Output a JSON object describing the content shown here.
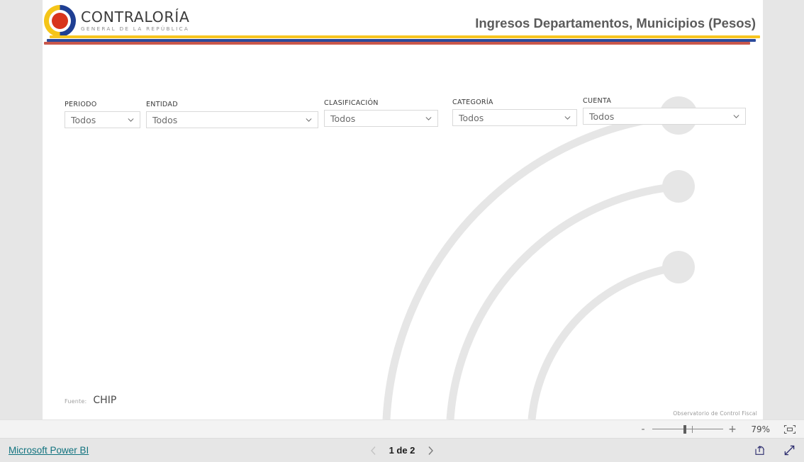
{
  "app": {
    "brand_name": "Microsoft Power BI",
    "background_color": "#e6e6e6"
  },
  "report": {
    "title": "Ingresos Departamentos, Municipios (Pesos)",
    "logo": {
      "name": "CONTRALORÍA",
      "tagline": "GENERAL DE LA REPÚBLICA",
      "icon": "contraloria-logo-icon",
      "ring_left_color": "#f5c518",
      "ring_right_color": "#1f3f93",
      "center_color": "#d8341c"
    },
    "rule_colors": {
      "yellow": "#f7c520",
      "blue": "#2b4a9b",
      "red": "#c0392b"
    }
  },
  "slicers": [
    {
      "label": "PERIODO",
      "value": "Todos",
      "chevron": "chevron-down-icon"
    },
    {
      "label": "ENTIDAD",
      "value": "Todos",
      "chevron": "chevron-down-icon"
    },
    {
      "label": "CLASIFICACIÓN",
      "value": "Todos",
      "chevron": "chevron-down-icon"
    },
    {
      "label": "CATEGORÍA",
      "value": "Todos",
      "chevron": "chevron-down-icon"
    },
    {
      "label": "CUENTA",
      "value": "Todos",
      "chevron": "chevron-down-icon"
    }
  ],
  "footer": {
    "source_label": "Fuente:",
    "source_value": "CHIP",
    "watermark": "Observatorio de Control Fiscal"
  },
  "zoom_bar": {
    "minus_label": "-",
    "plus_label": "+",
    "level": "79%",
    "fit_icon": "fit-to-page-icon"
  },
  "status_bar": {
    "brand_link": "Microsoft Power BI",
    "prev_icon": "chevron-left-icon",
    "next_icon": "chevron-right-icon",
    "page_text": "1 de 2",
    "share_icon": "share-icon",
    "fullscreen_icon": "fullscreen-icon",
    "link_color": "#11737f"
  }
}
